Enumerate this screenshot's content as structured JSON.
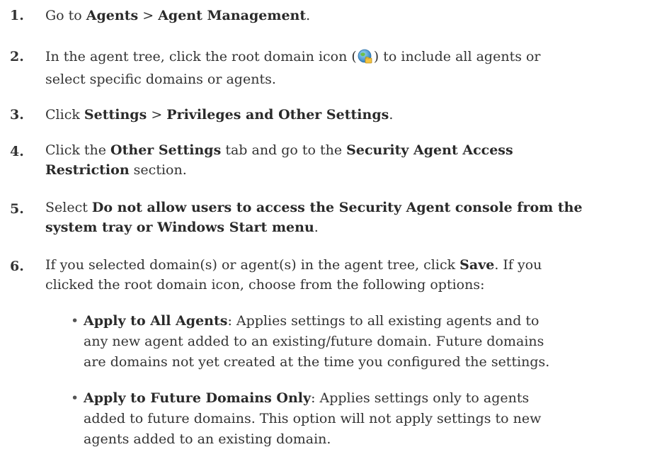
{
  "steps": [
    {
      "num": "1.",
      "p1": "Go to ",
      "b1": "Agents",
      "p2": " > ",
      "b2": "Agent Management",
      "p3": "."
    },
    {
      "num": "2.",
      "p1": "In the agent tree, click the root domain icon (",
      "icon": "root-domain-globe-icon",
      "p2": ") to include all agents or",
      "p3": "select specific domains or agents."
    },
    {
      "num": "3.",
      "p1": "Click ",
      "b1": "Settings",
      "p2": " > ",
      "b2": "Privileges and Other Settings",
      "p3": "."
    },
    {
      "num": "4.",
      "p1": "Click the ",
      "b1": "Other Settings",
      "p2": " tab and go to the ",
      "b2": "Security Agent Access",
      "b3": "Restriction",
      "p3": " section."
    },
    {
      "num": "5.",
      "p1": "Select ",
      "b1": "Do not allow users to access the Security Agent console from the",
      "b2": "system tray or Windows Start menu",
      "p2": "."
    },
    {
      "num": "6.",
      "p1": "If you selected domain(s) or agent(s) in the agent tree, click ",
      "b1": "Save",
      "p2": ". If you",
      "p3": "clicked the root domain icon, choose from the following options:"
    }
  ],
  "options": [
    {
      "bullet": "•",
      "b": "Apply to All Agents",
      "l1": ": Applies settings to all existing agents and to",
      "l2": "any new agent added to an existing/future domain. Future domains",
      "l3": "are domains not yet created at the time you configured the settings."
    },
    {
      "bullet": "•",
      "b": "Apply to Future Domains Only",
      "l1": ": Applies settings only to agents",
      "l2": "added to future domains. This option will not apply settings to new",
      "l3": "agents added to an existing domain."
    }
  ]
}
